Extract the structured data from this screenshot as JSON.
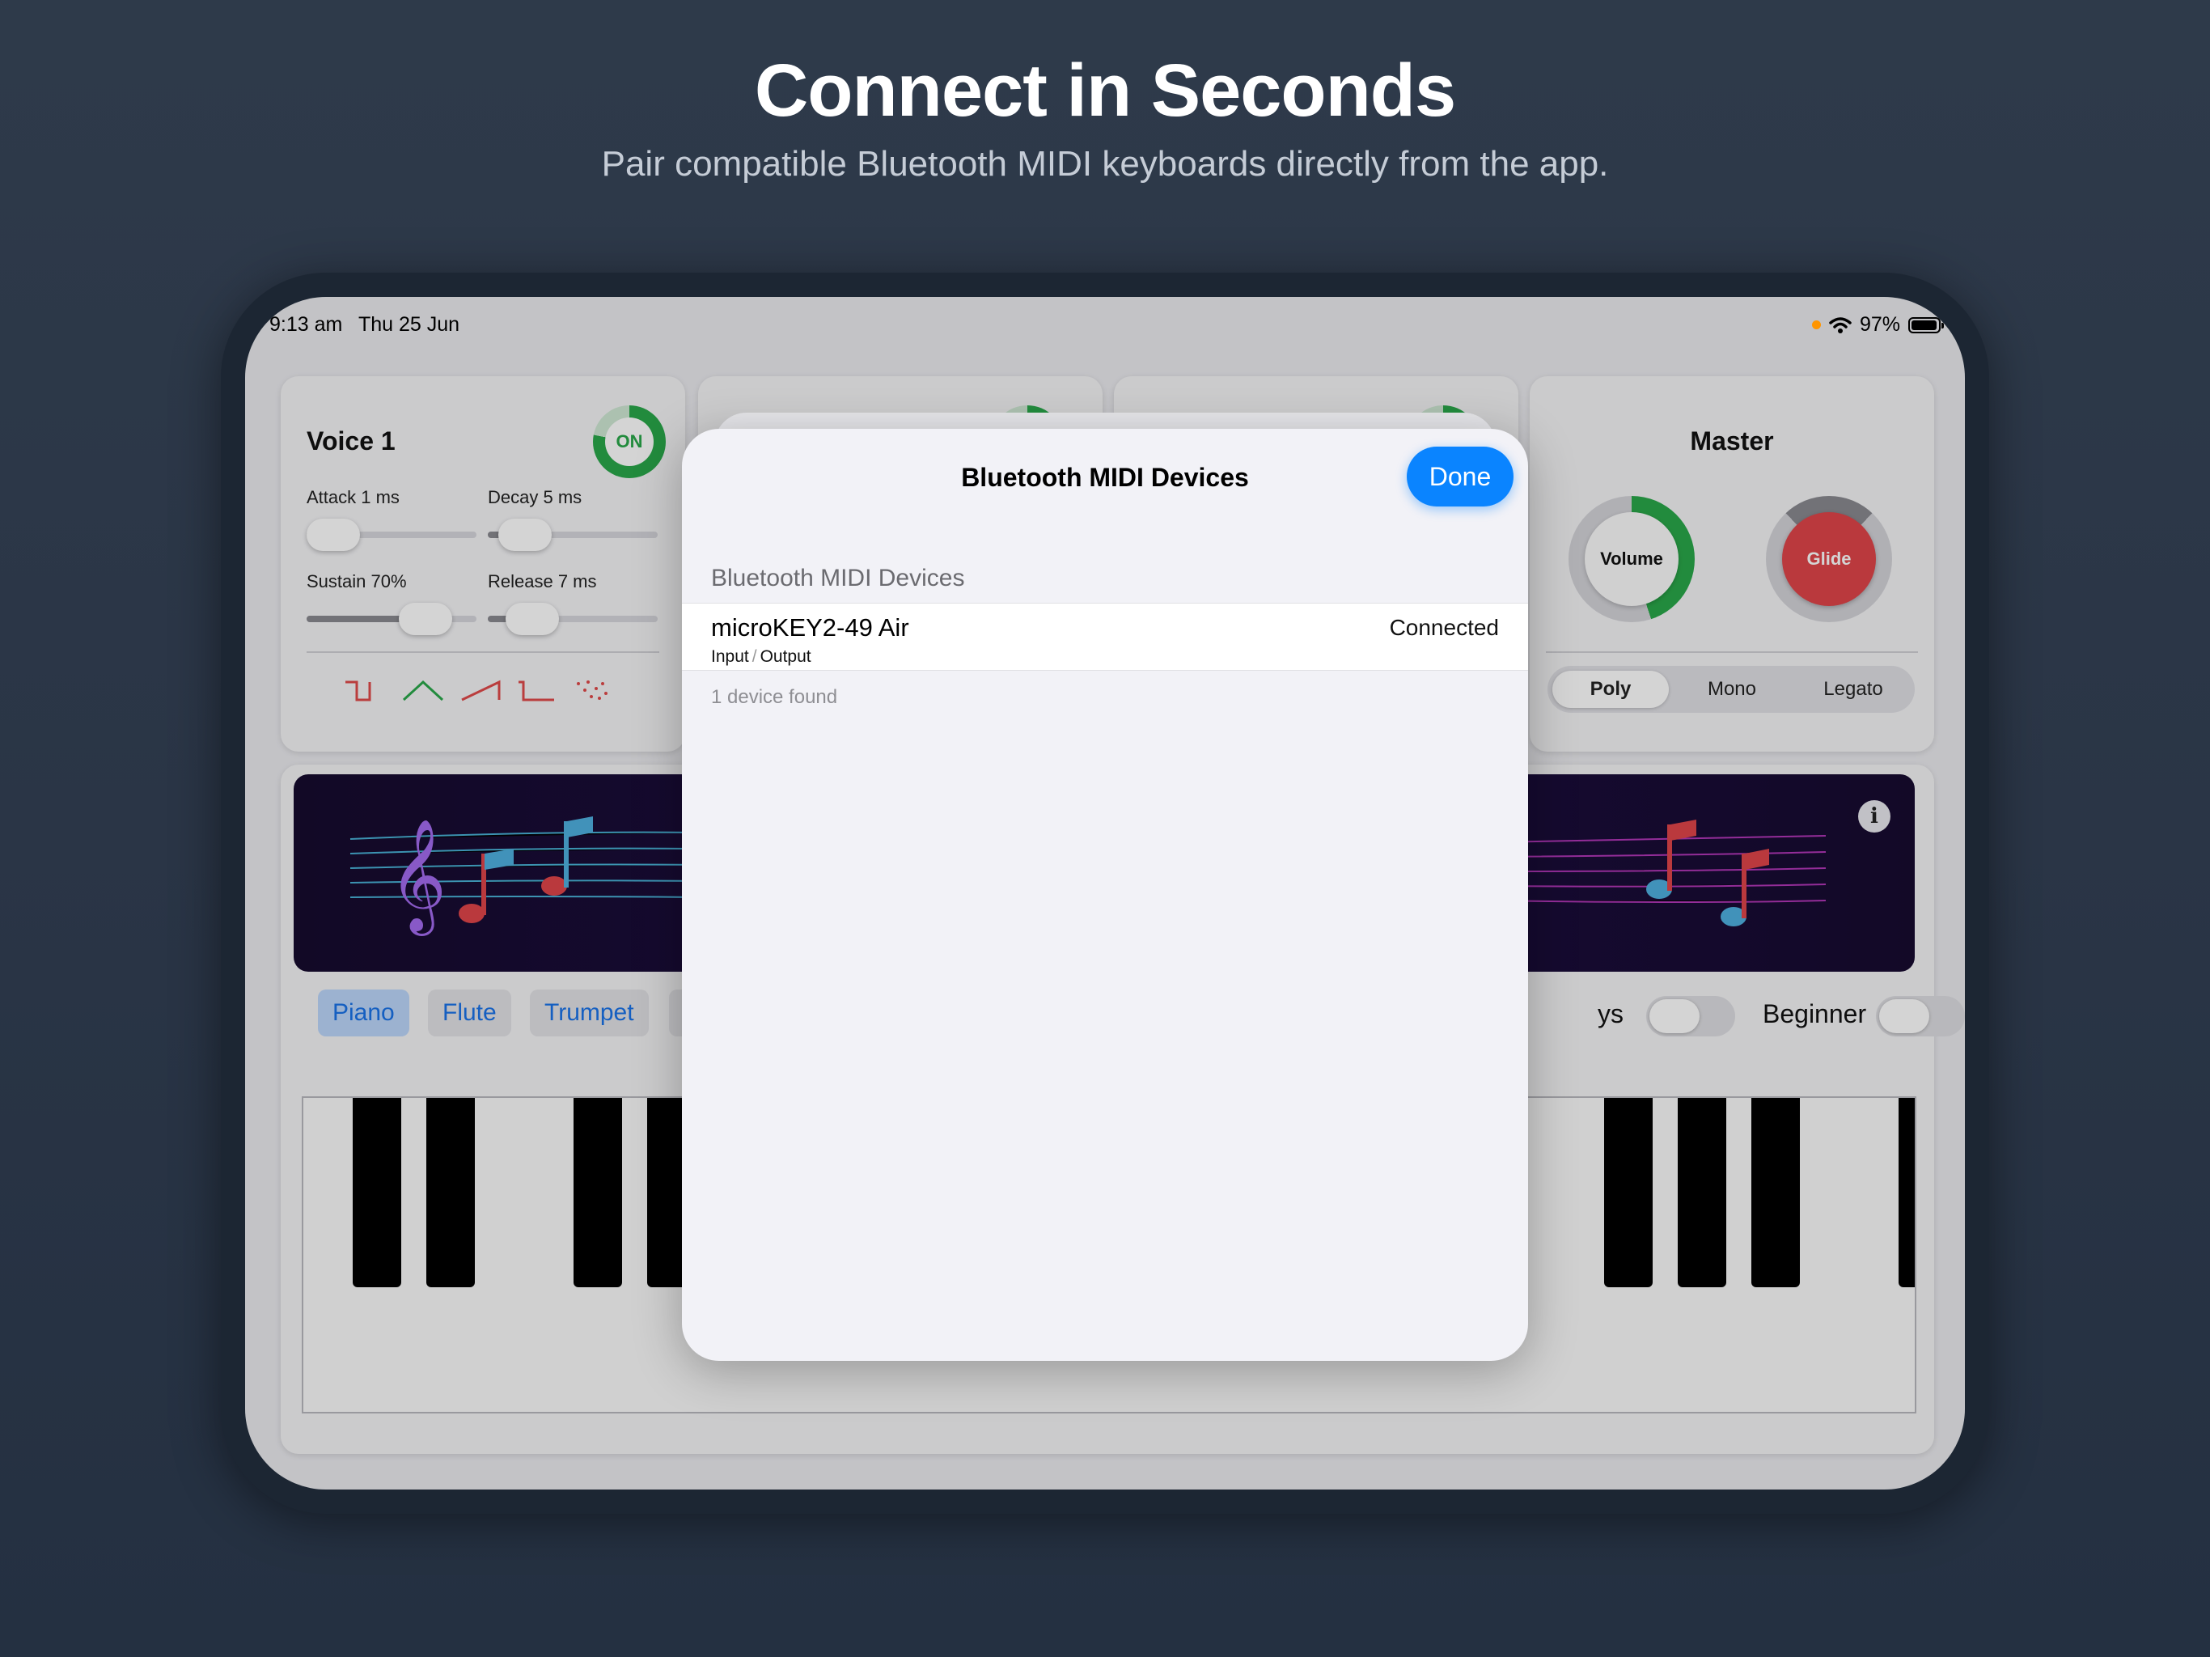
{
  "headline": "Connect in Seconds",
  "subheadline": "Pair compatible Bluetooth MIDI keyboards directly from the app.",
  "status_bar": {
    "time": "9:13 am",
    "date": "Thu 25 Jun",
    "battery": "97%"
  },
  "voice": {
    "title": "Voice 1",
    "power_label": "ON",
    "attack_label": "Attack 1 ms",
    "decay_label": "Decay 5 ms",
    "sustain_label": "Sustain 70%",
    "release_label": "Release 7 ms",
    "attack_value": 0.08,
    "decay_value": 0.22,
    "sustain_value": 0.7,
    "release_value": 0.26,
    "waveforms": [
      "square-wave-icon",
      "triangle-wave-icon",
      "sawtooth-wave-icon",
      "pulse-wave-icon",
      "noise-wave-icon"
    ]
  },
  "master": {
    "title": "Master",
    "volume_label": "Volume",
    "glide_label": "Glide",
    "volume_level": 0.45,
    "modes": [
      "Poly",
      "Mono",
      "Legato"
    ],
    "selected_mode": "Poly"
  },
  "instruments": [
    "Piano",
    "Flute",
    "Trumpet"
  ],
  "selected_instrument": "Piano",
  "toggles": {
    "partial_label": "ys",
    "beginner_label": "Beginner"
  },
  "sheet": {
    "title": "Bluetooth MIDI Devices",
    "done_label": "Done",
    "section_header": "Bluetooth MIDI Devices",
    "devices": [
      {
        "name": "microKEY2-49 Air",
        "io_in": "Input",
        "io_out": "Output",
        "status": "Connected"
      }
    ],
    "footer": "1 device found"
  },
  "colors": {
    "accent": "#0a84ff",
    "on_green": "#2aa84a",
    "glide_red": "#e0454a",
    "wave_red": "#e04a4a",
    "wave_green": "#2aa84a"
  }
}
